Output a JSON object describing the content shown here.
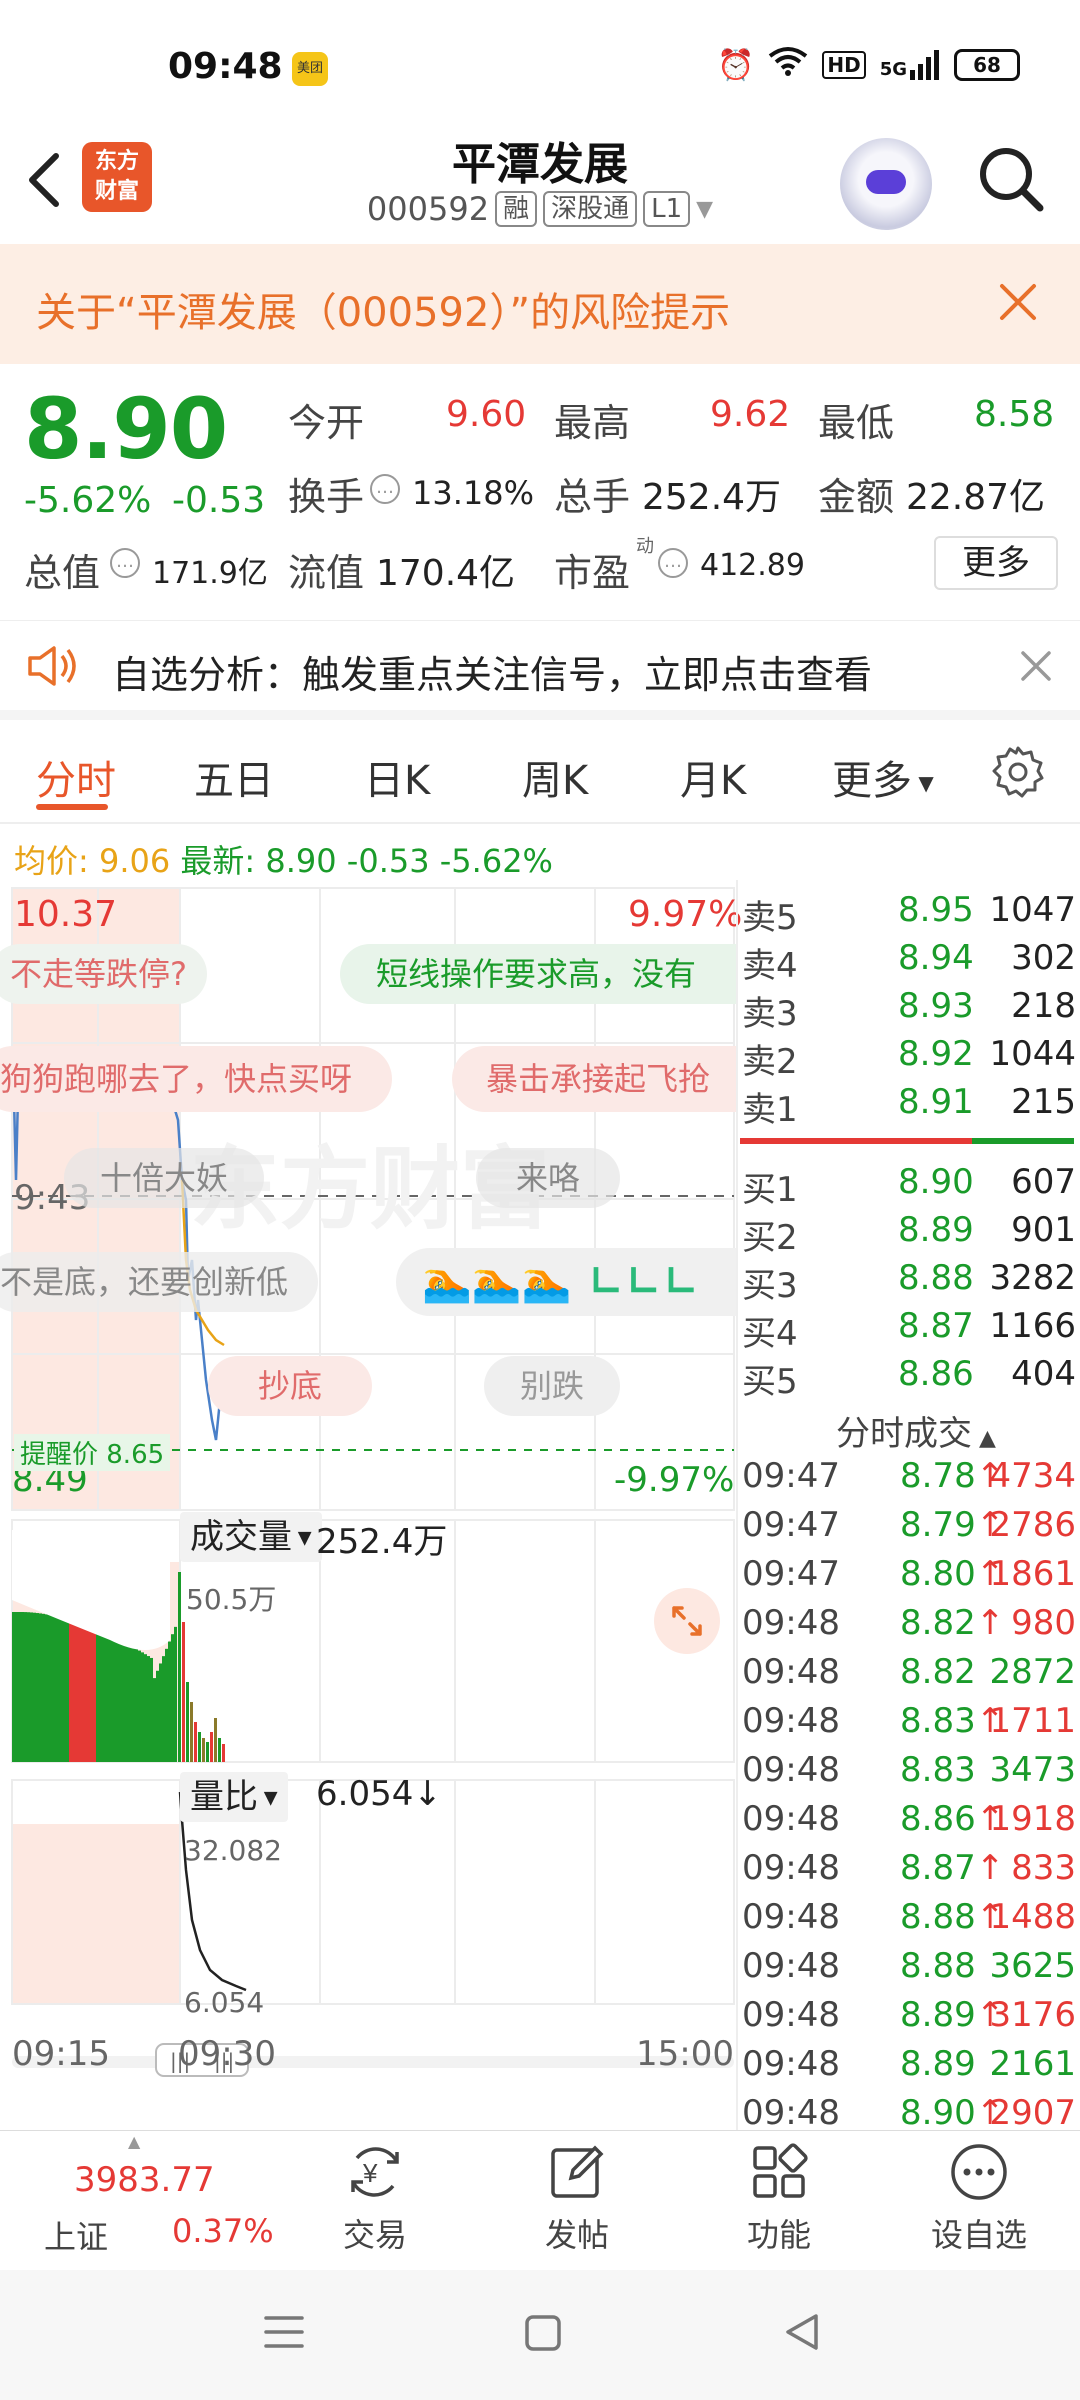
{
  "status": {
    "time": "09:48",
    "app_badge": "美团",
    "battery": "68",
    "hd": "HD",
    "net": "5G"
  },
  "nav": {
    "logo_line1": "东方",
    "logo_line2": "财富",
    "title": "平潭发展",
    "code": "000592",
    "tags": [
      "融",
      "深股通",
      "L1"
    ]
  },
  "risk": {
    "text": "关于“平潭发展（000592）”的风险提示"
  },
  "quote": {
    "price": "8.90",
    "change_pct": "-5.62%",
    "change_abs": "-0.53",
    "open_label": "今开",
    "open": "9.60",
    "high_label": "最高",
    "high": "9.62",
    "low_label": "最低",
    "low": "8.58",
    "turnover_label": "换手",
    "turnover": "13.18%",
    "volume_label": "总手",
    "volume": "252.4万",
    "amount_label": "金额",
    "amount": "22.87亿",
    "mcap_label": "总值",
    "mcap": "171.9亿",
    "float_label": "流值",
    "float": "170.4亿",
    "pe_label": "市盈",
    "pe_sup": "动",
    "pe": "412.89",
    "more": "更多"
  },
  "notice": {
    "text": "自选分析：触发重点关注信号，立即点击查看"
  },
  "tabs": [
    "分时",
    "五日",
    "日K",
    "周K",
    "月K",
    "更多"
  ],
  "avg": {
    "avg_label": "均价:",
    "avg": "9.06",
    "latest_label": "最新:",
    "latest": "8.90",
    "chg": "-0.53",
    "pct": "-5.62%"
  },
  "chart": {
    "top_price": "10.37",
    "top_pct": "9.97%",
    "bottom_price": "8.49",
    "bottom_pct": "-9.97%",
    "cursor_time": "9:43",
    "alert_label": "提醒价 8.65",
    "bubbles": [
      "不走等跌停?",
      "短线操作要求高，没有",
      "狗狗跑哪去了，快点买呀",
      "暴击承接起飞抢",
      "十倍大妖",
      "来咯",
      "不是底，还要创新低",
      "抄底",
      "别跌"
    ],
    "watermark": "东方财富",
    "vol_label": "成交量",
    "vol_total": "252.4万",
    "vol_max": "50.5万",
    "ratio_label": "量比",
    "ratio_value": "6.054",
    "ratio_arrow": "↓",
    "ratio_max": "32.082",
    "ratio_min": "6.054",
    "time_start": "09:15",
    "time_mid": "09:30",
    "time_end": "15:00"
  },
  "orderbook": {
    "asks": [
      {
        "label": "卖5",
        "price": "8.95",
        "qty": "1047"
      },
      {
        "label": "卖4",
        "price": "8.94",
        "qty": "302"
      },
      {
        "label": "卖3",
        "price": "8.93",
        "qty": "218"
      },
      {
        "label": "卖2",
        "price": "8.92",
        "qty": "1044"
      },
      {
        "label": "卖1",
        "price": "8.91",
        "qty": "215"
      }
    ],
    "bids": [
      {
        "label": "买1",
        "price": "8.90",
        "qty": "607"
      },
      {
        "label": "买2",
        "price": "8.89",
        "qty": "901"
      },
      {
        "label": "买3",
        "price": "8.88",
        "qty": "3282"
      },
      {
        "label": "买4",
        "price": "8.87",
        "qty": "1166"
      },
      {
        "label": "买5",
        "price": "8.86",
        "qty": "404"
      }
    ]
  },
  "trades": {
    "header": "分时成交",
    "rows": [
      {
        "time": "09:47",
        "price": "8.78",
        "arrow": "↑",
        "qty": "4734"
      },
      {
        "time": "09:47",
        "price": "8.79",
        "arrow": "↑",
        "qty": "2786"
      },
      {
        "time": "09:47",
        "price": "8.80",
        "arrow": "↑",
        "qty": "1861"
      },
      {
        "time": "09:48",
        "price": "8.82",
        "arrow": "↑",
        "qty": "980"
      },
      {
        "time": "09:48",
        "price": "8.82",
        "arrow": "",
        "qty": "2872"
      },
      {
        "time": "09:48",
        "price": "8.83",
        "arrow": "↑",
        "qty": "1711"
      },
      {
        "time": "09:48",
        "price": "8.83",
        "arrow": "",
        "qty": "3473"
      },
      {
        "time": "09:48",
        "price": "8.86",
        "arrow": "↑",
        "qty": "1918"
      },
      {
        "time": "09:48",
        "price": "8.87",
        "arrow": "↑",
        "qty": "833"
      },
      {
        "time": "09:48",
        "price": "8.88",
        "arrow": "↑",
        "qty": "1488"
      },
      {
        "time": "09:48",
        "price": "8.88",
        "arrow": "",
        "qty": "3625"
      },
      {
        "time": "09:48",
        "price": "8.89",
        "arrow": "↑",
        "qty": "3176"
      },
      {
        "time": "09:48",
        "price": "8.89",
        "arrow": "",
        "qty": "2161"
      },
      {
        "time": "09:48",
        "price": "8.90",
        "arrow": "↑",
        "qty": "2907"
      }
    ]
  },
  "bottom": {
    "index_value": "3983.77",
    "index_name": "上证",
    "index_pct": "0.37%",
    "items": [
      "交易",
      "发帖",
      "功能",
      "设自选"
    ]
  },
  "colors": {
    "up": "#e53935",
    "down": "#1a9b2a",
    "accent": "#e8562a",
    "avg": "#e8a317"
  }
}
